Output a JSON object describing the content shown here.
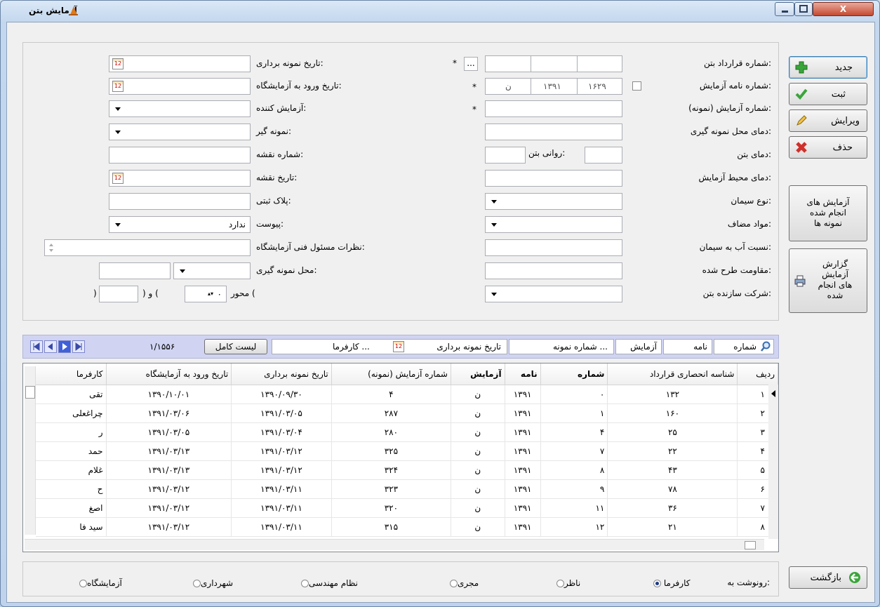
{
  "window": {
    "title": "آزمایش بتن",
    "close": "X"
  },
  "side": {
    "new": "جدید",
    "save": "ثبت",
    "edit": "ویرایش",
    "delete": "حذف",
    "done_tests": [
      "آزمایش های",
      "انجام شده",
      "نمونه ها"
    ],
    "report": [
      "گزارش",
      "آزمایش",
      "های انجام",
      "شده"
    ],
    "back": "بازگشت"
  },
  "form": {
    "contract_no": "شماره قرارداد بتن:",
    "dots": "...",
    "test_letter_no": "شماره نامه آزمایش:",
    "letter_parts": [
      "ن",
      "۱۳۹۱",
      "۱۶۲۹"
    ],
    "test_no": "شماره آزمایش (نمونه):",
    "temp_sampling": "دمای محل نمونه گیری:",
    "concrete_temp": "دمای بتن:",
    "slump": "روانی بتن:",
    "env_temp": "دمای محیط آزمایش:",
    "cement_type": "نوع سیمان:",
    "additives": "مواد مضاف:",
    "wc_ratio": "نسبت آب به سیمان:",
    "design_strength": "مقاومت طرح شده:",
    "producer": "شرکت سازنده بتن:",
    "sampling_date": "تاریخ نمونه برداری:",
    "lab_entry_date": "تاریخ ورود به آزمایشگاه:",
    "tester": "آزمایش کننده:",
    "sampler": "نمونه گیر:",
    "map_no": "شماره نقشه:",
    "map_date": "تاریخ نقشه:",
    "plate": "پلاک ثبتی:",
    "attachment": "پیوست:",
    "attachment_value": "ندارد",
    "lab_comments": "نظرات مسئول فنی آزمایشگاه:",
    "sampling_place": "محل نمونه گیری:",
    "axis": "محور (",
    "axis_value": "۰",
    "and": ")  و  (",
    "close_paren": ")",
    "star": "*",
    "cal": "12"
  },
  "nav": {
    "page": "۱/۱۵۵۶",
    "full_list": "لیست کامل",
    "filters": {
      "number": "شماره",
      "letter": "نامه",
      "test": "آزمایش",
      "sample_no": "شماره نمونه ...",
      "sampling_date": "تاریخ نمونه برداری",
      "employer": "کارفرما ..."
    }
  },
  "grid": {
    "headers": [
      "ردیف",
      "شناسه انحصاری قرارداد",
      "شماره",
      "نامه",
      "آزمایش",
      "شماره آزمایش (نمونه)",
      "تاریخ نمونه برداری",
      "تاریخ ورود به آزمایشگاه",
      "کارفرما"
    ],
    "rows": [
      [
        "۱",
        "۱۳۲",
        "۰",
        "۱۳۹۱",
        "ن",
        "۴",
        "۱۳۹۰/۰۹/۳۰",
        "۱۳۹۰/۱۰/۰۱",
        "تقی"
      ],
      [
        "۲",
        "۱۶۰",
        "۱",
        "۱۳۹۱",
        "ن",
        "۲۸۷",
        "۱۳۹۱/۰۳/۰۵",
        "۱۳۹۱/۰۳/۰۶",
        "چراغعلی"
      ],
      [
        "۳",
        "۲۵",
        "۴",
        "۱۳۹۱",
        "ن",
        "۲۸۰",
        "۱۳۹۱/۰۳/۰۴",
        "۱۳۹۱/۰۳/۰۵",
        "ر"
      ],
      [
        "۴",
        "۲۲",
        "۷",
        "۱۳۹۱",
        "ن",
        "۳۲۵",
        "۱۳۹۱/۰۳/۱۲",
        "۱۳۹۱/۰۳/۱۳",
        "حمد"
      ],
      [
        "۵",
        "۴۳",
        "۸",
        "۱۳۹۱",
        "ن",
        "۳۲۴",
        "۱۳۹۱/۰۳/۱۲",
        "۱۳۹۱/۰۳/۱۳",
        "غلام"
      ],
      [
        "۶",
        "۷۸",
        "۹",
        "۱۳۹۱",
        "ن",
        "۳۲۳",
        "۱۳۹۱/۰۳/۱۱",
        "۱۳۹۱/۰۳/۱۲",
        "ح"
      ],
      [
        "۷",
        "۳۶",
        "۱۱",
        "۱۳۹۱",
        "ن",
        "۳۲۰",
        "۱۳۹۱/۰۳/۱۱",
        "۱۳۹۱/۰۳/۱۲",
        "اصغ"
      ],
      [
        "۸",
        "۲۱",
        "۱۲",
        "۱۳۹۱",
        "ن",
        "۳۱۵",
        "۱۳۹۱/۰۳/۱۱",
        "۱۳۹۱/۰۳/۱۲",
        "سید فا"
      ]
    ]
  },
  "copies": {
    "label": "رونوشت به:",
    "options": [
      "کارفرما",
      "ناظر",
      "مجری",
      "نظام مهندسی",
      "شهرداری",
      "آزمایشگاه"
    ],
    "selected": "کارفرما"
  },
  "colors": {
    "accent": "#d0d4f2",
    "window": "#c3d7ee"
  }
}
